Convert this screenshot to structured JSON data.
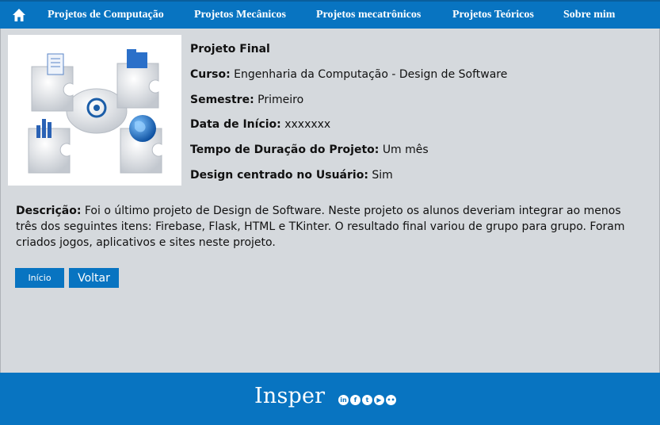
{
  "nav": {
    "items": [
      "Projetos de Computação",
      "Projetos Mecânicos",
      "Projetos mecatrônicos",
      "Projetos Teóricos",
      "Sobre mim"
    ]
  },
  "project": {
    "title": "Projeto Final",
    "course_label": "Curso:",
    "course_value": "Engenharia da Computação - Design de Software",
    "semester_label": "Semestre:",
    "semester_value": "Primeiro",
    "start_label": "Data de Início:",
    "start_value": "xxxxxxx",
    "duration_label": "Tempo de Duração do Projeto:",
    "duration_value": "Um mês",
    "ucd_label": "Design centrado no Usuário:",
    "ucd_value": "Sim",
    "description_label": "Descrição:",
    "description_text": "Foi o último projeto de  Design de Software. Neste projeto os alunos deveriam integrar ao menos três dos seguintes itens: Firebase, Flask, HTML e TKinter. O resultado final variou de grupo para grupo. Foram criados jogos, aplicativos e sites neste projeto."
  },
  "buttons": {
    "home": "Início",
    "back": "Voltar"
  },
  "footer": {
    "brand": "Insper",
    "social_icons": [
      "linkedin-icon",
      "facebook-icon",
      "twitter-icon",
      "youtube-icon",
      "flickr-icon"
    ]
  },
  "colors": {
    "accent": "#0874c1",
    "background": "#d5d9dd"
  }
}
